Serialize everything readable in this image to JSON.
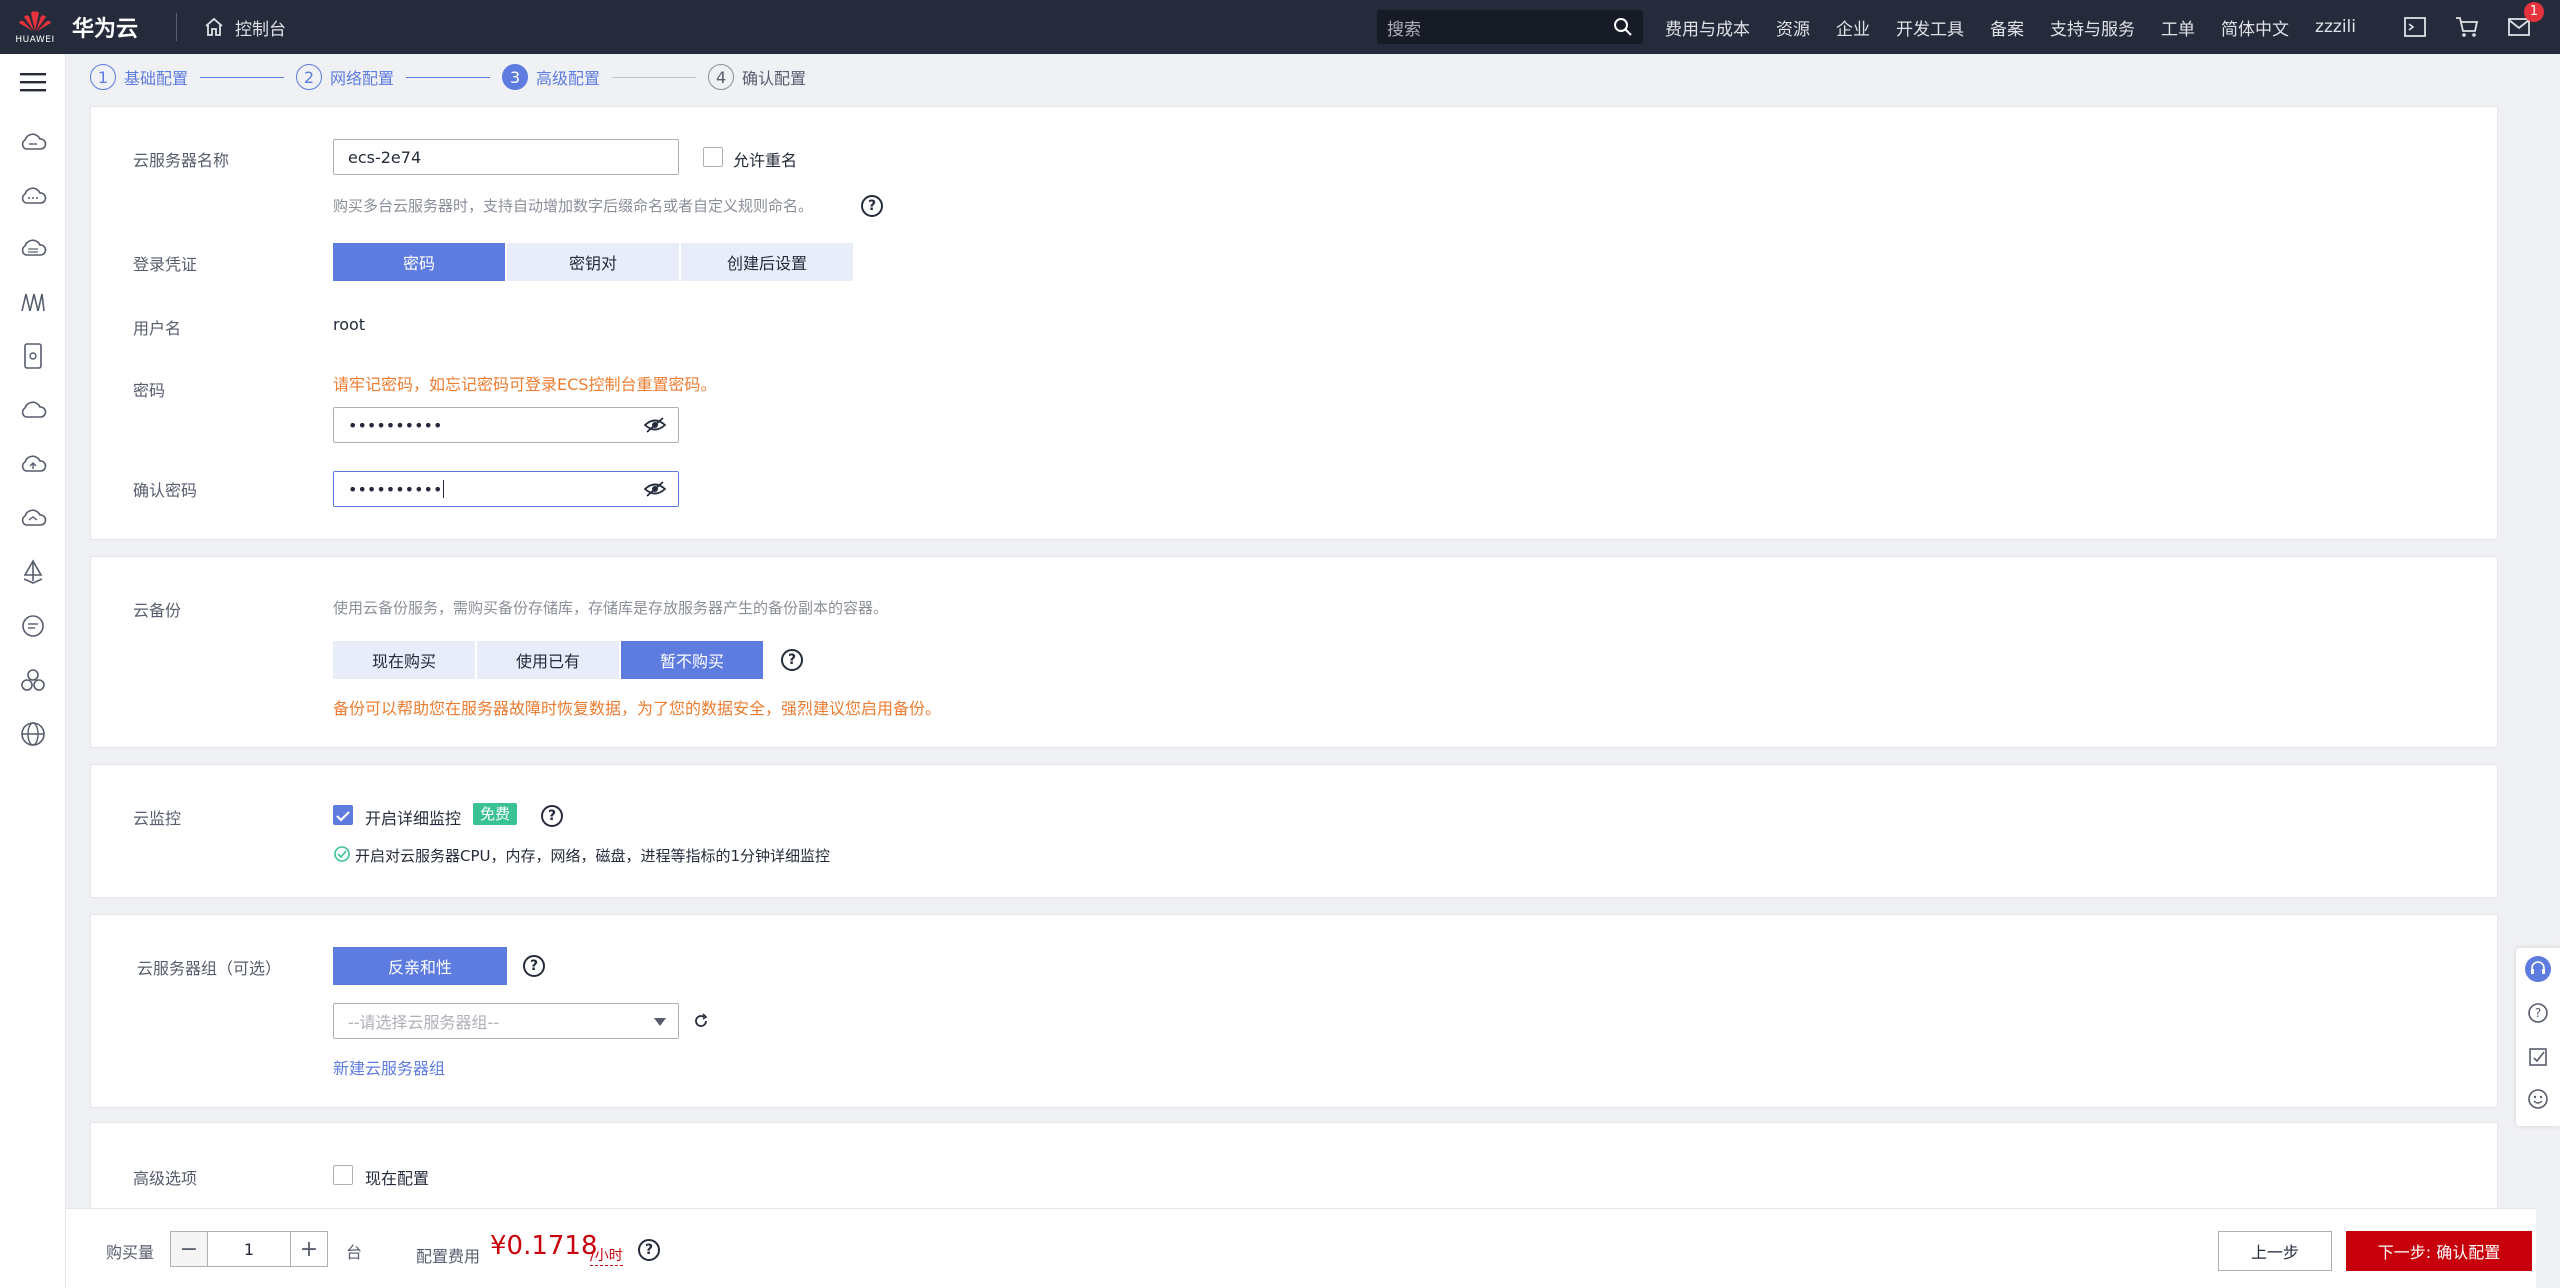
{
  "topbar": {
    "logo_text": "HUAWEI",
    "brand": "华为云",
    "console": "控制台",
    "search_placeholder": "搜索",
    "nav": [
      "费用与成本",
      "资源",
      "企业",
      "开发工具",
      "备案",
      "支持与服务",
      "工单",
      "简体中文",
      "zzzili"
    ],
    "mail_badge": "1"
  },
  "steps": [
    {
      "num": "1",
      "label": "基础配置"
    },
    {
      "num": "2",
      "label": "网络配置"
    },
    {
      "num": "3",
      "label": "高级配置"
    },
    {
      "num": "4",
      "label": "确认配置"
    }
  ],
  "basic": {
    "name_label": "云服务器名称",
    "name_value": "ecs-2e74",
    "allow_dup_label": "允许重名",
    "name_hint": "购买多台云服务器时，支持自动增加数字后缀命名或者自定义规则命名。",
    "cred_label": "登录凭证",
    "cred_options": [
      "密码",
      "密钥对",
      "创建后设置"
    ],
    "user_label": "用户名",
    "user_value": "root",
    "pwd_label": "密码",
    "pwd_warning": "请牢记密码，如忘记密码可登录ECS控制台重置密码。",
    "pwd_value": "••••••••••",
    "confirm_label": "确认密码",
    "confirm_value": "••••••••••"
  },
  "backup": {
    "label": "云备份",
    "desc": "使用云备份服务，需购买备份存储库，存储库是存放服务器产生的备份副本的容器。",
    "options": [
      "现在购买",
      "使用已有",
      "暂不购买"
    ],
    "warning": "备份可以帮助您在服务器故障时恢复数据，为了您的数据安全，强烈建议您启用备份。"
  },
  "monitor": {
    "label": "云监控",
    "check_label": "开启详细监控",
    "free_tag": "免费",
    "desc": "开启对云服务器CPU，内存，网络，磁盘，进程等指标的1分钟详细监控"
  },
  "group": {
    "label": "云服务器组（可选）",
    "policy": "反亲和性",
    "select_placeholder": "--请选择云服务器组--",
    "new_link": "新建云服务器组"
  },
  "advanced": {
    "label": "高级选项",
    "check_label": "现在配置"
  },
  "footer": {
    "qty_label": "购买量",
    "qty_value": "1",
    "unit": "台",
    "fee_label": "配置费用",
    "price": "¥0.1718",
    "price_unit": "/小时",
    "prev": "上一步",
    "next": "下一步: 确认配置"
  },
  "colors": {
    "primary": "#5e7ce0",
    "warning": "#ed7c30",
    "danger": "#c7000b",
    "topbar": "#252b3a"
  }
}
